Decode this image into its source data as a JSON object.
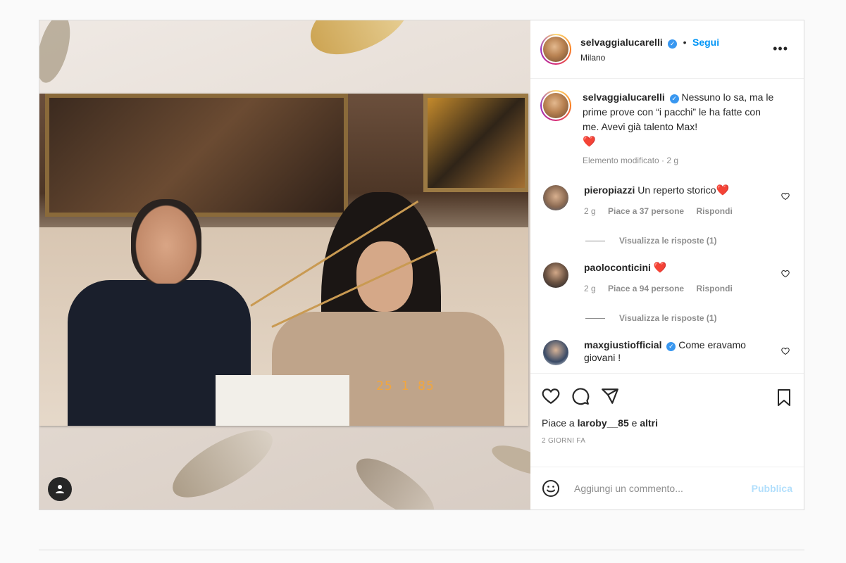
{
  "post": {
    "author": {
      "username": "selvaggialucarelli",
      "verified_icon": "verified-badge-icon",
      "follow_label": "Segui",
      "location": "Milano",
      "more_label": "•••"
    },
    "caption": {
      "username": "selvaggialucarelli",
      "text": "Nessuno lo sa, ma le prime prove con “i pacchi” le ha fatte con me. Avevi già talento Max!",
      "emoji": "❤️",
      "meta": "Elemento modificato · 2 g"
    },
    "comments": [
      {
        "username": "pieropiazzi",
        "text": "Un reperto storico",
        "emoji": "❤️",
        "age": "2 g",
        "likes": "Piace a 37 persone",
        "reply": "Rispondi",
        "view_replies": "Visualizza le risposte (1)"
      },
      {
        "username": "paoloconticini",
        "text": "",
        "emoji": "❤️",
        "age": "2 g",
        "likes": "Piace a 94 persone",
        "reply": "Rispondi",
        "view_replies": "Visualizza le risposte (1)"
      },
      {
        "username": "maxgiustiofficial",
        "text": "Come eravamo giovani !",
        "emoji": ""
      }
    ],
    "likes_prefix": "Piace a",
    "likes_user": "laroby__85",
    "likes_suffix": "e",
    "likes_others": "altri",
    "date": "2 giorni fa",
    "add_comment": {
      "placeholder": "Aggiungi un commento...",
      "publish_label": "Pubblica"
    },
    "photo_stamp": "25 1 85"
  },
  "colors": {
    "link_blue": "#0095f6",
    "publish_disabled": "#b2dffc",
    "heart_red": "#ed2a3f",
    "muted": "#8e8e8e"
  }
}
